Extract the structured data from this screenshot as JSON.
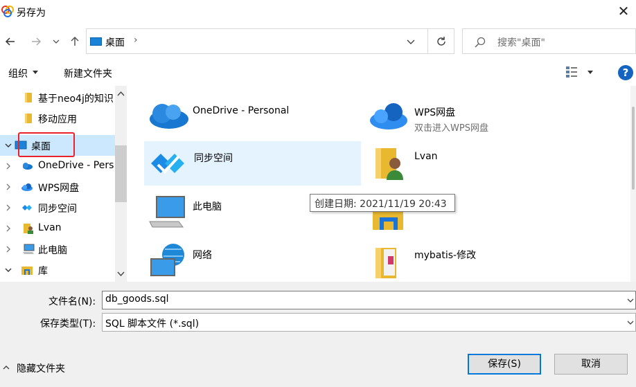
{
  "window": {
    "title": "另存为"
  },
  "address": {
    "location": "桌面",
    "search_placeholder": "搜索\"桌面\""
  },
  "toolbar": {
    "organize_label": "组织",
    "new_folder_label": "新建文件夹",
    "help_label": "?"
  },
  "nav_tree": [
    {
      "label": "基于neo4j的知识",
      "icon": "folder-icon"
    },
    {
      "label": "移动应用",
      "icon": "folder-icon"
    },
    {
      "label": "桌面",
      "icon": "desktop-icon",
      "selected": true
    },
    {
      "label": "OneDrive - Pers",
      "icon": "onedrive-icon"
    },
    {
      "label": "WPS网盘",
      "icon": "wps-cloud-icon"
    },
    {
      "label": "同步空间",
      "icon": "sync-space-icon"
    },
    {
      "label": "Lvan",
      "icon": "user-folder-icon"
    },
    {
      "label": "此电脑",
      "icon": "computer-icon"
    },
    {
      "label": "库",
      "icon": "library-icon"
    }
  ],
  "files": [
    {
      "name": "OneDrive - Personal",
      "sub": "",
      "icon": "onedrive-icon"
    },
    {
      "name": "WPS网盘",
      "sub": "双击进入WPS网盘",
      "icon": "wps-cloud-icon"
    },
    {
      "name": "同步空间",
      "sub": "",
      "icon": "sync-space-icon",
      "hover": true
    },
    {
      "name": "Lvan",
      "sub": "",
      "icon": "user-folder-icon"
    },
    {
      "name": "此电脑",
      "sub": "",
      "icon": "computer-icon"
    },
    {
      "name": "",
      "sub": "",
      "icon": "library-icon"
    },
    {
      "name": "网络",
      "sub": "",
      "icon": "network-icon"
    },
    {
      "name": "mybatis-修改",
      "sub": "",
      "icon": "folder-icon"
    }
  ],
  "tooltip": "创建日期: 2021/11/19 20:43",
  "form": {
    "filename_label": "文件名(N):",
    "filename_value": "db_goods.sql",
    "filetype_label": "保存类型(T):",
    "filetype_value": "SQL 脚本文件 (*.sql)"
  },
  "footer": {
    "hide_folders_label": "隐藏文件夹",
    "save_label": "保存(S)",
    "cancel_label": "取消"
  },
  "colors": {
    "selection": "#cce8ff",
    "hover": "#e5f3ff",
    "accent": "#0078d7",
    "highlight_box": "#e8212b"
  }
}
